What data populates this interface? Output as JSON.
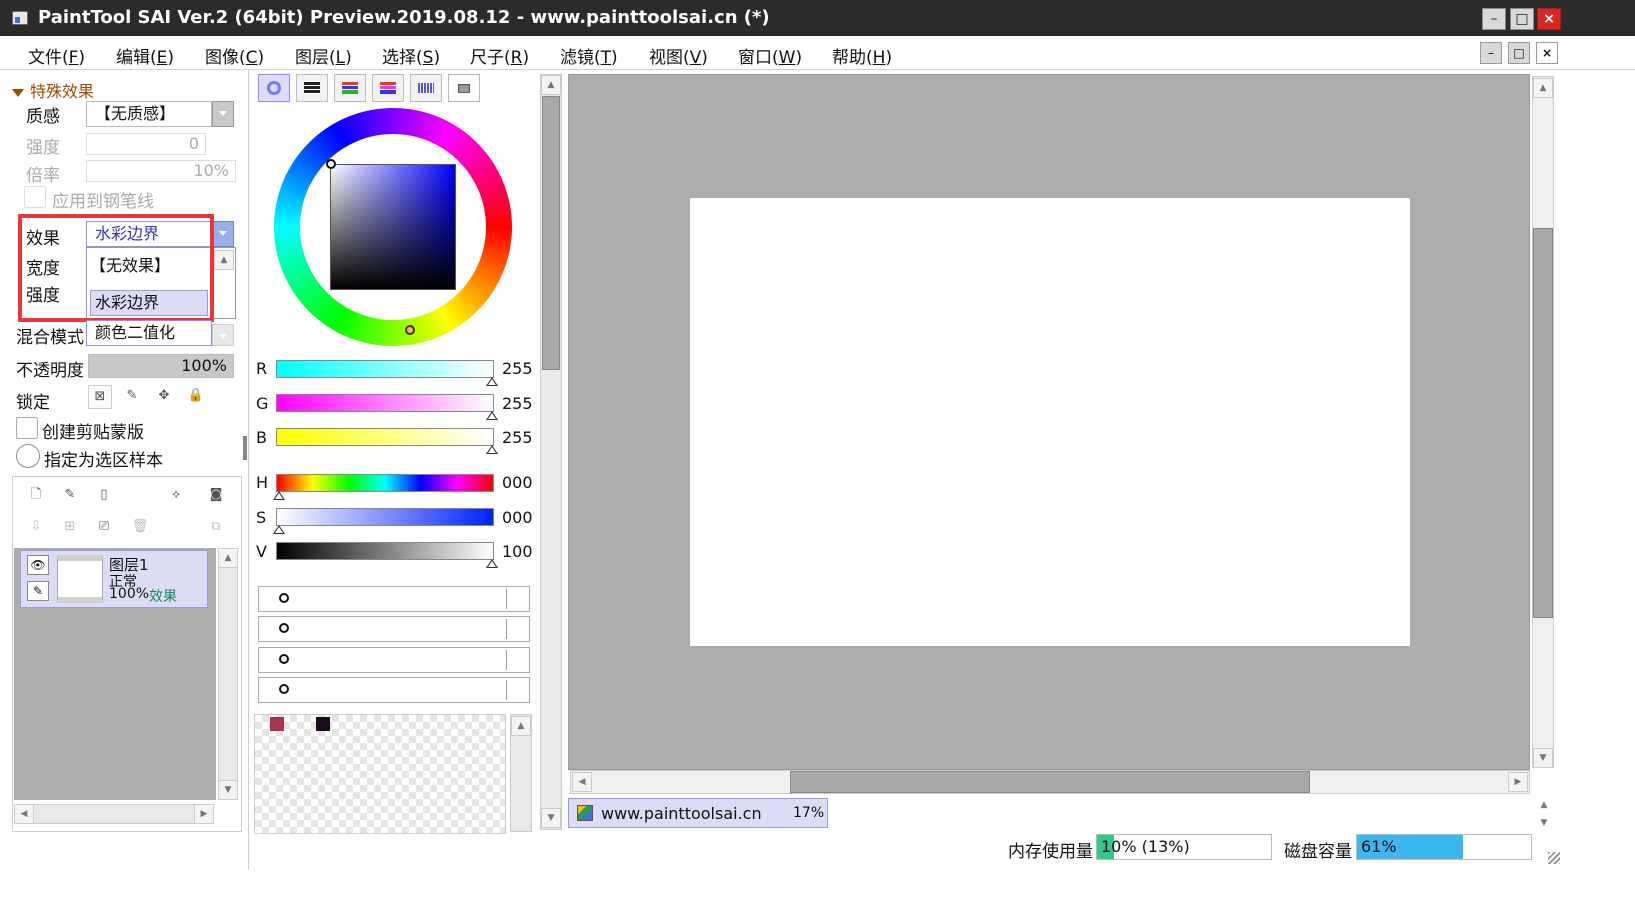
{
  "window": {
    "title": "PaintTool SAI Ver.2 (64bit) Preview.2019.08.12 - www.painttoolsai.cn (*)",
    "min_label": "–",
    "max_label": "□",
    "close_label": "×"
  },
  "menu": [
    {
      "label": "文件(",
      "key": "F",
      "tail": ")"
    },
    {
      "label": "编辑(",
      "key": "E",
      "tail": ")"
    },
    {
      "label": "图像(",
      "key": "C",
      "tail": ")"
    },
    {
      "label": "图层(",
      "key": "L",
      "tail": ")"
    },
    {
      "label": "选择(",
      "key": "S",
      "tail": ")"
    },
    {
      "label": "尺子(",
      "key": "R",
      "tail": ")"
    },
    {
      "label": "滤镜(",
      "key": "T",
      "tail": ")"
    },
    {
      "label": "视图(",
      "key": "V",
      "tail": ")"
    },
    {
      "label": "窗口(",
      "key": "W",
      "tail": ")"
    },
    {
      "label": "帮助(",
      "key": "H",
      "tail": ")"
    }
  ],
  "effects": {
    "header": "特殊效果",
    "texture_label": "质感",
    "texture_value": "【无质感】",
    "intensity_label": "强度",
    "intensity_value": "0",
    "scale_label": "倍率",
    "scale_value": "10%",
    "apply_pen_label": "应用到钢笔线",
    "effect_label": "效果",
    "effect_value": "水彩边界",
    "width_label": "宽度",
    "strength_label": "强度",
    "dropdown_options": [
      "【无效果】",
      "水彩边界"
    ],
    "blend_label": "混合模式",
    "blend_value": "颜色二值化",
    "opacity_label": "不透明度",
    "opacity_value": "100%",
    "lock_label": "锁定",
    "clip_label": "创建剪贴蒙版",
    "sample_label": "指定为选区样本"
  },
  "layers": [
    {
      "name": "图层1",
      "mode": "正常",
      "opacity": "100%",
      "effect": "效果"
    }
  ],
  "color": {
    "r_label": "R",
    "r_value": "255",
    "g_label": "G",
    "g_value": "255",
    "b_label": "B",
    "b_value": "255",
    "h_label": "H",
    "h_value": "000",
    "s_label": "S",
    "s_value": "000",
    "v_label": "V",
    "v_value": "100",
    "swatch_colors": [
      "#a8334f",
      "#1d0a1c"
    ]
  },
  "navigator": {
    "name": "www.painttoolsai.cn",
    "zoom": "17%"
  },
  "status": {
    "memory_label": "内存使用量",
    "memory_value": "10% (13%)",
    "memory_fraction": 0.1,
    "disk_label": "磁盘容量",
    "disk_value": "61%",
    "disk_fraction": 0.61
  },
  "colors": {
    "accent_lavender": "#dcdcf6",
    "highlight_red": "#e8373b",
    "memory_fill": "#34c98a",
    "disk_fill": "#3cb6ee"
  }
}
